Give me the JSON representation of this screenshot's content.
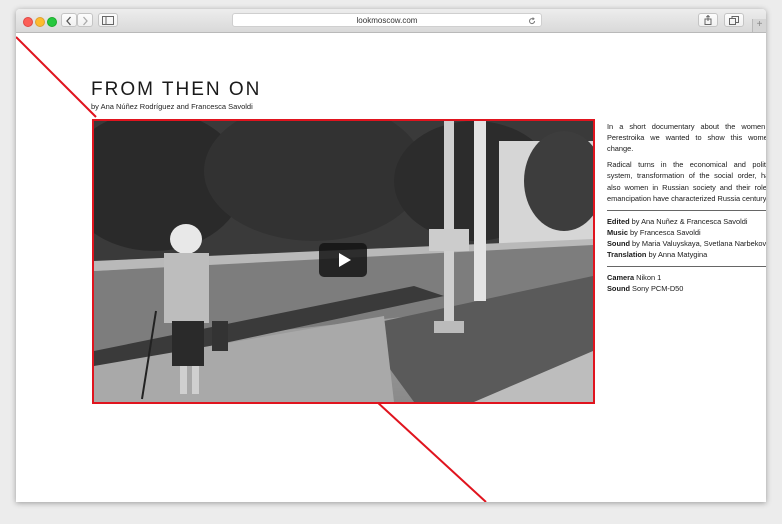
{
  "browser": {
    "url": "lookmoscow.com",
    "nav_back_icon": "chevron-left-icon",
    "nav_forward_icon": "chevron-right-icon",
    "sidebar_icon": "sidebar-icon",
    "reload_icon": "reload-icon",
    "share_icon": "share-icon",
    "tabs_icon": "tabs-icon",
    "new_tab_label": "+"
  },
  "page": {
    "title": "FROM THEN ON",
    "byline": "by Ana Núñez Rodríguez and Francesca Savoldi",
    "accent_color": "#e0141e"
  },
  "sidebar": {
    "paragraphs": [
      "In a short documentary about the women in Perestroika we wanted to show this women's change.",
      "Radical turns in the economical and political system, transformation of the social order, have also women in Russian society and their role of emancipation have characterized Russia century."
    ],
    "credits_1": [
      {
        "label": "Edited",
        "value": " by Ana Nuñez & Francesca Savoldi"
      },
      {
        "label": "Music",
        "value": " by Francesca Savoldi"
      },
      {
        "label": "Sound",
        "value": " by Maria Valuyskaya, Svetlana Narbekova"
      },
      {
        "label": "Translation",
        "value": " by Anna Matygina"
      }
    ],
    "credits_2": [
      {
        "label": "Camera",
        "value": " Nikon 1"
      },
      {
        "label": "Sound",
        "value": " Sony PCM-D50"
      }
    ]
  }
}
